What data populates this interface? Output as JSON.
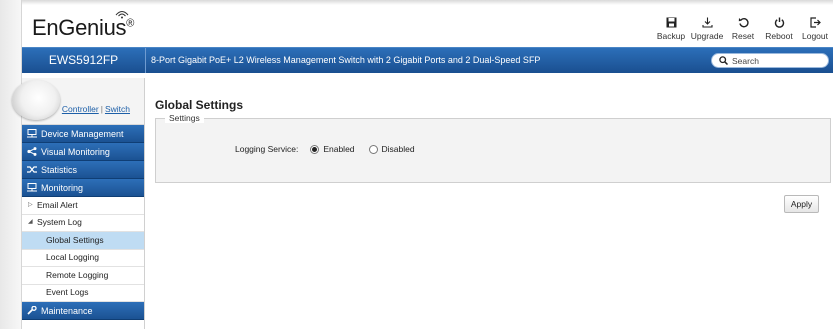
{
  "header": {
    "logo_text": "EnGenius",
    "logo_reg": "®",
    "actions": [
      {
        "label": "Backup",
        "icon": "save-icon"
      },
      {
        "label": "Upgrade",
        "icon": "download-icon"
      },
      {
        "label": "Reset",
        "icon": "reset-icon"
      },
      {
        "label": "Reboot",
        "icon": "power-icon"
      },
      {
        "label": "Logout",
        "icon": "logout-icon"
      }
    ]
  },
  "bar": {
    "model": "EWS5912FP",
    "description": "8-Port Gigabit PoE+ L2 Wireless Management Switch with 2 Gigabit Ports and 2 Dual-Speed SFP",
    "search_placeholder": "Search"
  },
  "sidebar": {
    "controller": "Controller",
    "separator": "|",
    "switch": "Switch",
    "sections": [
      {
        "label": "Device Management",
        "icon": "device-icon"
      },
      {
        "label": "Visual Monitoring",
        "icon": "share-icon"
      },
      {
        "label": "Statistics",
        "icon": "shuffle-icon"
      },
      {
        "label": "Monitoring",
        "icon": "monitor-icon"
      }
    ],
    "items": {
      "email_alert": "Email Alert",
      "system_log": "System Log",
      "global_settings": "Global Settings",
      "local_logging": "Local Logging",
      "remote_logging": "Remote Logging",
      "event_logs": "Event Logs"
    },
    "maintenance": "Maintenance"
  },
  "main": {
    "title": "Global Settings",
    "settings_legend": "Settings",
    "logging_label": "Logging Service:",
    "enabled_label": "Enabled",
    "disabled_label": "Disabled",
    "selected": "Enabled",
    "apply_label": "Apply"
  },
  "colors": {
    "brand_blue": "#1f5a9e",
    "active_item": "#bfdcf3"
  }
}
